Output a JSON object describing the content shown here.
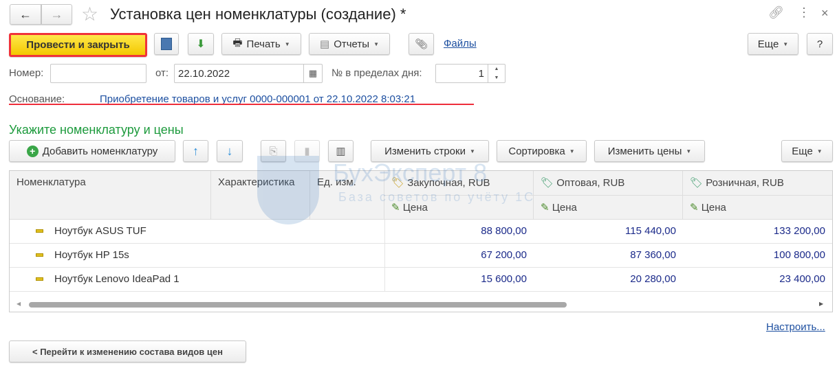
{
  "title": "Установка цен номенклатуры (создание) *",
  "toolbar": {
    "post_close": "Провести и закрыть",
    "print": "Печать",
    "reports": "Отчеты",
    "files": "Файлы",
    "more": "Еще",
    "help": "?"
  },
  "form": {
    "number_label": "Номер:",
    "number_value": "",
    "date_label": "от:",
    "date_value": "22.10.2022",
    "day_label": "№ в пределах дня:",
    "day_value": "1",
    "basis_label": "Основание:",
    "basis_link": "Приобретение товаров и услуг 0000-000001 от 22.10.2022 8:03:21"
  },
  "section_title": "Укажите номенклатуру и цены",
  "table_toolbar": {
    "add": "Добавить номенклатуру",
    "change_rows": "Изменить строки",
    "sort": "Сортировка",
    "change_prices": "Изменить цены",
    "more": "Еще"
  },
  "columns": {
    "item": "Номенклатура",
    "characteristic": "Характеристика",
    "unit": "Ед. изм.",
    "purchase": "Закупочная, RUB",
    "wholesale": "Оптовая, RUB",
    "retail": "Розничная, RUB",
    "price": "Цена"
  },
  "rows": [
    {
      "name": "Ноутбук ASUS TUF",
      "purchase": "88 800,00",
      "wholesale": "115 440,00",
      "retail": "133 200,00"
    },
    {
      "name": "Ноутбук HP 15s",
      "purchase": "67 200,00",
      "wholesale": "87 360,00",
      "retail": "100 800,00"
    },
    {
      "name": "Ноутбук Lenovo IdeaPad 1",
      "purchase": "15 600,00",
      "wholesale": "20 280,00",
      "retail": "23 400,00"
    }
  ],
  "watermark": {
    "brand": "БухЭксперт 8",
    "tagline": "База советов по учёту 1С"
  },
  "customize_link": "Настроить...",
  "back_button": "< Перейти к изменению состава видов цен"
}
